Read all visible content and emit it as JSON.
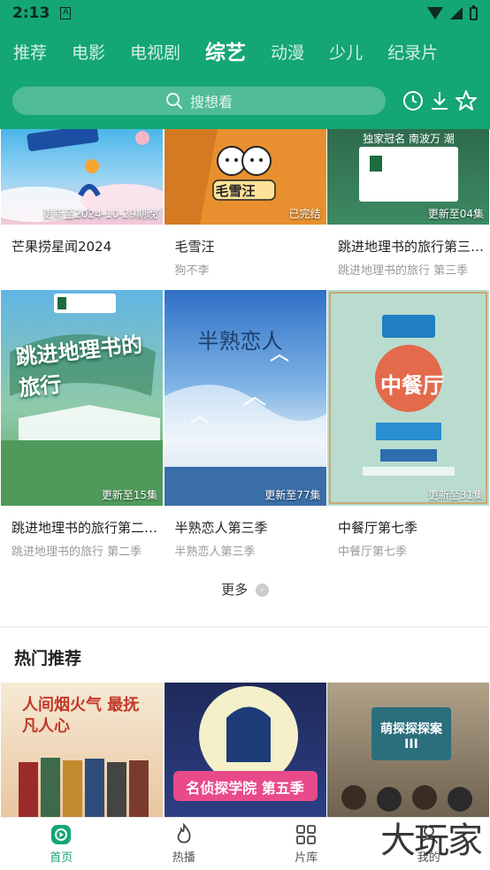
{
  "status_bar": {
    "time": "2:13",
    "notification": "A"
  },
  "tabs": [
    {
      "label": "推荐",
      "active": false
    },
    {
      "label": "电影",
      "active": false
    },
    {
      "label": "电视剧",
      "active": false
    },
    {
      "label": "综艺",
      "active": true
    },
    {
      "label": "动漫",
      "active": false
    },
    {
      "label": "少儿",
      "active": false
    },
    {
      "label": "纪录片",
      "active": false
    }
  ],
  "search": {
    "placeholder": "搜想看"
  },
  "header_icons": [
    "history-icon",
    "download-icon",
    "favorite-icon"
  ],
  "grid": [
    {
      "title": "芒果捞星闻2024",
      "subtitle": "",
      "badge": "更新至2024-10-29期晚",
      "poster_text": ""
    },
    {
      "title": "毛雪汪",
      "subtitle": "狗不李",
      "badge": "已完结",
      "poster_text": "毛雪汪"
    },
    {
      "title": "跳进地理书的旅行第三…",
      "subtitle": "跳进地理书的旅行 第三季",
      "badge": "更新至04集",
      "poster_text": "独家冠名 南波万 潮流服饰"
    },
    {
      "title": "跳进地理书的旅行第二…",
      "subtitle": "跳进地理书的旅行 第二季",
      "badge": "更新至15集",
      "poster_text": "跳进地理书的旅行"
    },
    {
      "title": "半熟恋人第三季",
      "subtitle": "半熟恋人第三季",
      "badge": "更新至77集",
      "poster_text": "半熟恋人"
    },
    {
      "title": "中餐厅第七季",
      "subtitle": "中餐厅第七季",
      "badge": "更新至31集",
      "poster_text": "中餐厅"
    }
  ],
  "more": {
    "label": "更多"
  },
  "hot_section": {
    "title": "热门推荐",
    "posters": [
      {
        "poster_text": "人间烟火气 最抚凡人心"
      },
      {
        "poster_text": "名侦探学院 第五季"
      },
      {
        "poster_text": "萌探探探案 III"
      }
    ]
  },
  "bottom_nav": [
    {
      "label": "首页",
      "icon": "home-play-icon",
      "active": true
    },
    {
      "label": "热播",
      "icon": "flame-icon",
      "active": false
    },
    {
      "label": "片库",
      "icon": "grid-icon",
      "active": false
    },
    {
      "label": "我的",
      "icon": "profile-icon",
      "active": false
    }
  ],
  "watermark": "大玩家",
  "colors": {
    "brand": "#14a673",
    "muted": "#999999"
  }
}
